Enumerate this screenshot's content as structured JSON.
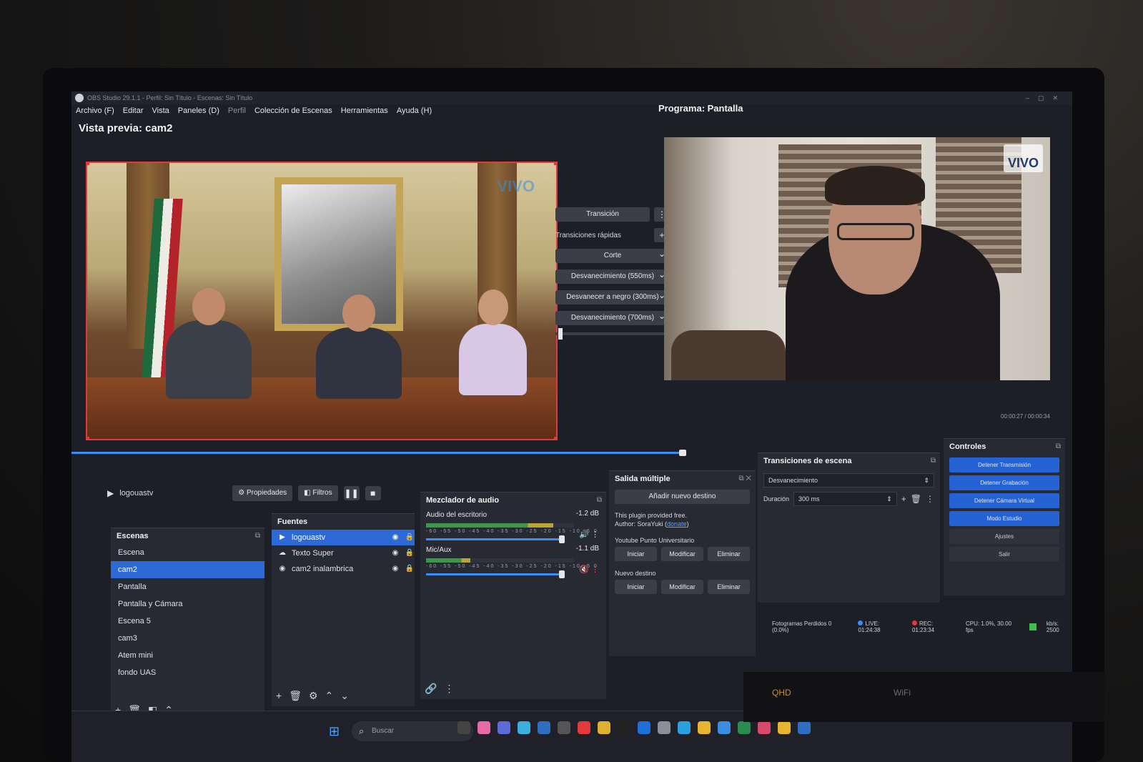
{
  "window": {
    "title": "OBS Studio 29.1.1 - Perfil: Sin Título - Escenas: Sin Título"
  },
  "menu": {
    "items": [
      {
        "label": "Archivo (F)",
        "muted": false
      },
      {
        "label": "Editar",
        "muted": false
      },
      {
        "label": "Vista",
        "muted": false
      },
      {
        "label": "Paneles (D)",
        "muted": false
      },
      {
        "label": "Perfil",
        "muted": true
      },
      {
        "label": "Colección de Escenas",
        "muted": false
      },
      {
        "label": "Herramientas",
        "muted": false
      },
      {
        "label": "Ayuda (H)",
        "muted": false
      }
    ]
  },
  "preview": {
    "label": "Vista previa: cam2",
    "overlay_text": "VIVO"
  },
  "program": {
    "label": "Programa: Pantalla",
    "badge": "VIVO",
    "timecode": "00:00:27 / 00:00:34"
  },
  "transitions_panel": {
    "transition_label": "Transición",
    "quick_label": "Transiciones rápidas",
    "options": [
      "Corte",
      "Desvanecimiento (550ms)",
      "Desvanecer a negro (300ms)",
      "Desvanecimiento (700ms)"
    ]
  },
  "source_toolbar": {
    "current_source": "logouastv",
    "properties_label": "Propiedades",
    "filters_label": "Filtros"
  },
  "scenes": {
    "title": "Escenas",
    "items": [
      "Escena",
      "cam2",
      "Pantalla",
      "Pantalla y Cámara",
      "Escena 5",
      "cam3",
      "Atem mini",
      "fondo UAS"
    ],
    "selected_index": 1
  },
  "sources": {
    "title": "Fuentes",
    "items": [
      {
        "label": "logouastv",
        "icon": "play-icon",
        "selected": true
      },
      {
        "label": "Texto Super",
        "icon": "text-icon",
        "selected": false
      },
      {
        "label": "cam2 inalambrica",
        "icon": "camera-icon",
        "selected": false
      }
    ]
  },
  "mixer": {
    "title": "Mezclador de audio",
    "channels": [
      {
        "name": "Audio del escritorio",
        "db": "-1.2 dB",
        "muted": false,
        "level": 0.86,
        "volume": 0.78
      },
      {
        "name": "Mic/Aux",
        "db": "-1.1 dB",
        "muted": true,
        "level": 0.3,
        "volume": 0.78
      }
    ],
    "scale": "-60 -55 -50 -45 -40 -35 -30 -25 -20 -15 -10 -5 0"
  },
  "multi_output": {
    "title": "Salida múltiple",
    "add_label": "Añadir nuevo destino",
    "note_line1": "This plugin provided free.",
    "note_author": "Author: SoraYuki (",
    "note_link": "donate",
    "note_close": ")",
    "destinations": [
      {
        "name": "Youtube Punto Universitario",
        "start": "Iniciar",
        "edit": "Modificar",
        "delete": "Eliminar"
      },
      {
        "name": "Nuevo destino",
        "start": "Iniciar",
        "edit": "Modificar",
        "delete": "Eliminar"
      }
    ]
  },
  "scene_transitions": {
    "title": "Transiciones de escena",
    "selected": "Desvanecimiento",
    "duration_label": "Duración",
    "duration_value": "300 ms"
  },
  "controls": {
    "title": "Controles",
    "buttons": [
      {
        "label": "Detener Transmisión",
        "style": "blue"
      },
      {
        "label": "Detener Grabación",
        "style": "blue"
      },
      {
        "label": "Detener Cámara Virtual",
        "style": "blue"
      },
      {
        "label": "Modo Estudio",
        "style": "blue"
      },
      {
        "label": "Ajustes",
        "style": "gray"
      },
      {
        "label": "Salir",
        "style": "gray"
      }
    ]
  },
  "status": {
    "dropped": "Fotogramas Perdidos 0 (0.0%)",
    "live": "LIVE: 01:24:38",
    "rec": "REC: 01:23:34",
    "cpu": "CPU: 1.0%, 30.00 fps",
    "kbps": "kb/s: 2500"
  },
  "taskbar": {
    "search_placeholder": "Buscar"
  },
  "keyboard": {
    "labels": [
      "QHD",
      "WiFi"
    ]
  },
  "colors": {
    "accent": "#2d6ad8",
    "selection_border": "#e23a3a",
    "panel_bg": "#272a33"
  }
}
